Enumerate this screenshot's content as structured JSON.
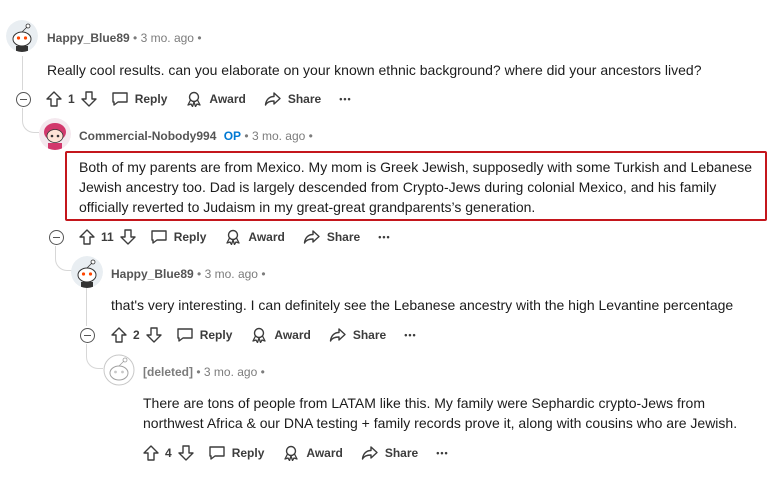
{
  "comments": [
    {
      "user": "Happy_Blue89",
      "op": "",
      "time": "3 mo. ago",
      "text": "Really cool results. can you elaborate on your known ethnic background? where did your ancestors lived?",
      "votes": "1"
    },
    {
      "user": "Commercial-Nobody994",
      "op": "OP",
      "time": "3 mo. ago",
      "text": "Both of my parents are from Mexico. My mom is Greek Jewish, supposedly with some Turkish and Lebanese Jewish ancestry too. Dad is largely descended from Crypto-Jews during colonial Mexico, and his family officially reverted to Judaism in my great-great grandparents’s generation.",
      "votes": "11"
    },
    {
      "user": "Happy_Blue89",
      "op": "",
      "time": "3 mo. ago",
      "text": "that's very interesting. I can definitely see the Lebanese ancestry with the high Levantine percentage",
      "votes": "2"
    },
    {
      "user": "[deleted]",
      "op": "",
      "time": "3 mo. ago",
      "text": "There are tons of people from LATAM like this. My family were Sephardic crypto-Jews from northwest Africa & our DNA testing + family records prove it, along with cousins who are Jewish.",
      "votes": "4"
    }
  ],
  "labels": {
    "separator": "•",
    "reply": "Reply",
    "award": "Award",
    "share": "Share",
    "more": "•••"
  },
  "icons": [
    "snoo-avatar-icon",
    "collapse-icon",
    "upvote-icon",
    "downvote-icon",
    "reply-icon",
    "award-icon",
    "share-icon",
    "more-icon"
  ],
  "colors": {
    "op": "#0079d3",
    "highlight": "#c4161c",
    "meta": "#7c7c7c"
  }
}
